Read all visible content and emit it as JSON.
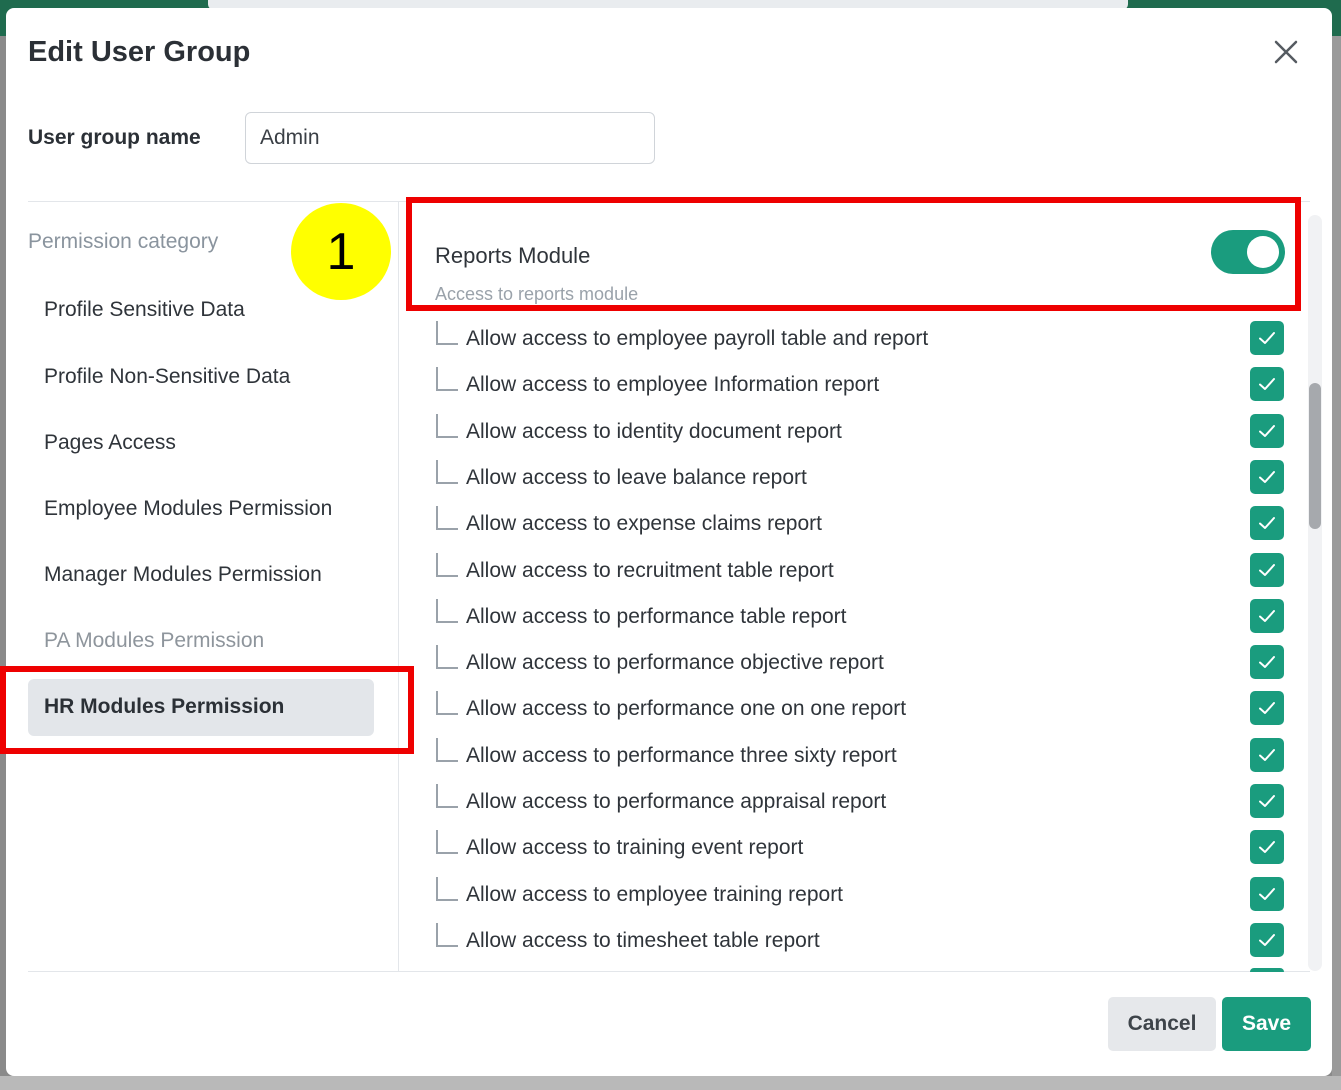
{
  "dialog": {
    "title": "Edit User Group",
    "user_group_label": "User group name",
    "user_group_value": "Admin"
  },
  "marker_label": "1",
  "categories": {
    "title": "Permission category",
    "items": [
      {
        "label": "Profile Sensitive Data"
      },
      {
        "label": "Profile Non-Sensitive Data"
      },
      {
        "label": "Pages Access"
      },
      {
        "label": "Employee Modules Permission"
      },
      {
        "label": "Manager Modules Permission"
      },
      {
        "label": "PA Modules Permission"
      },
      {
        "label": "HR Modules Permission"
      }
    ]
  },
  "module": {
    "title": "Reports Module",
    "subtitle": "Access to reports module"
  },
  "permissions": [
    "Allow access to employee payroll table and report",
    "Allow access to employee Information report",
    "Allow access to identity document report",
    "Allow access to leave balance report",
    "Allow access to expense claims report",
    "Allow access to recruitment table report",
    "Allow access to performance table report",
    "Allow access to performance objective report",
    "Allow access to performance one on one report",
    "Allow access to performance three sixty report",
    "Allow access to performance appraisal report",
    "Allow access to training event report",
    "Allow access to employee training report",
    "Allow access to timesheet table report"
  ],
  "footer": {
    "cancel_label": "Cancel",
    "save_label": "Save"
  },
  "colors": {
    "accent": "#1a9c7e",
    "highlight": "#ee0000",
    "marker": "#ffff00"
  }
}
